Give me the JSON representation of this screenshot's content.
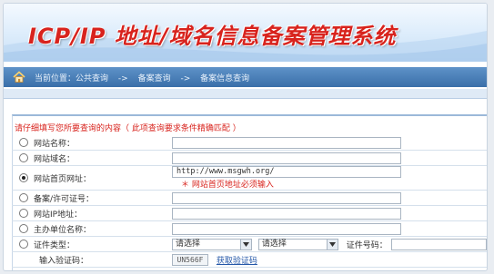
{
  "header": {
    "title": "ICP/IP 地址/域名信息备案管理系统"
  },
  "breadcrumb": {
    "prefix": "当前位置：公共查询",
    "sep1": "->",
    "item2": "备案查询",
    "sep2": "->",
    "item3": "备案信息查询"
  },
  "form": {
    "notice": "请仔细填写您所要查询的内容（ 此项查询要求条件精确匹配 ）",
    "rows": [
      {
        "label": "网站名称：",
        "value": "",
        "checked": false
      },
      {
        "label": "网站域名：",
        "value": "",
        "checked": false
      },
      {
        "label": "网站首页网址：",
        "value": "http://www.msgwh.org/",
        "checked": true,
        "hint": "＊ 网站首页地址必须输入"
      },
      {
        "label": "备案/许可证号：",
        "value": "",
        "checked": false
      },
      {
        "label": "网站IP地址：",
        "value": "",
        "checked": false
      },
      {
        "label": "主办单位名称：",
        "value": "",
        "checked": false
      }
    ],
    "cert": {
      "label": "证件类型：",
      "select1": "请选择",
      "select2": "请选择",
      "number_label": "证件号码：",
      "number_value": ""
    },
    "captcha": {
      "label": "输入验证码：",
      "code": "UN566F",
      "refresh": "获取验证码"
    }
  },
  "colors": {
    "accent_red": "#d8231d",
    "nav_blue": "#3a6fa9",
    "link": "#2457a8"
  }
}
